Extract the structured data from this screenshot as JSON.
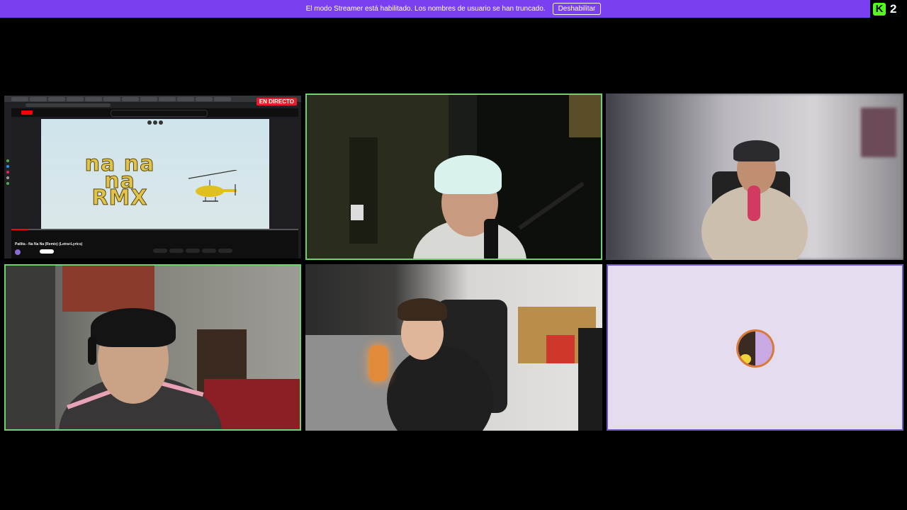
{
  "banner": {
    "message": "El modo Streamer está habilitado. Los nombres de usuario se han truncado.",
    "button_label": "Deshabilitar",
    "background": "#7b3ff2"
  },
  "kick": {
    "logo_letter": "K",
    "count": "2",
    "brand_color": "#53fc18"
  },
  "tiles": [
    {
      "kind": "screenshare",
      "live_badge": "EN DIRECTO"
    },
    {
      "kind": "webcam",
      "highlight": "#6fd16f"
    },
    {
      "kind": "webcam"
    },
    {
      "kind": "webcam",
      "highlight": "#6fd16f"
    },
    {
      "kind": "webcam"
    },
    {
      "kind": "avatar",
      "highlight": "#6f5bc5"
    }
  ],
  "screenshare": {
    "video_art_text": "na na na RMX",
    "video_art_line1": "na na na",
    "video_art_line2": "RMX",
    "video_title": "Pailita - Na Na Na (Remix) (Letra+Lyrics)",
    "progress_fraction": 0.06
  }
}
